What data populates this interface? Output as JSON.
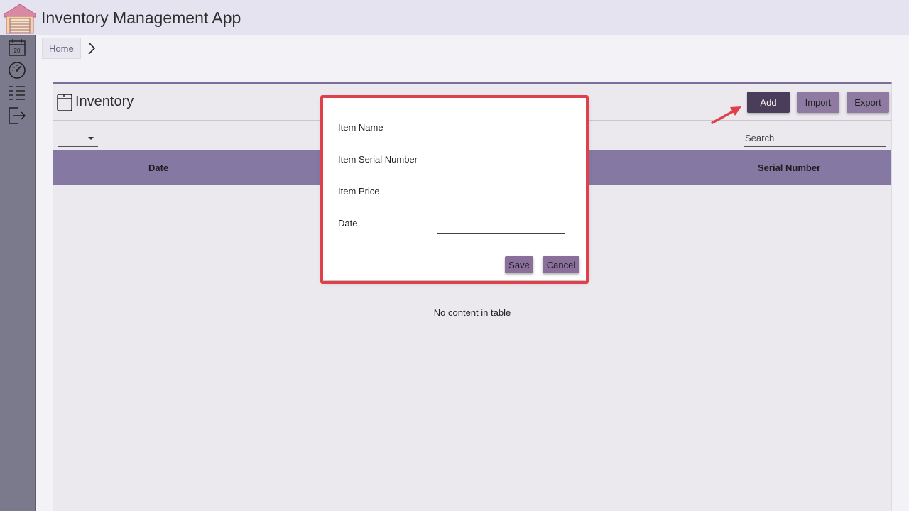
{
  "header": {
    "title": "Inventory Management App",
    "logo_icon": "warehouse-icon"
  },
  "sidebar": {
    "items": [
      {
        "icon": "calendar-icon",
        "text": "20"
      },
      {
        "icon": "dashboard-gauge-icon"
      },
      {
        "icon": "list-icon"
      },
      {
        "icon": "logout-icon"
      }
    ]
  },
  "breadcrumb": {
    "home": "Home"
  },
  "inventory": {
    "title": "Inventory",
    "buttons": {
      "add": "Add",
      "import": "Import",
      "export": "Export"
    },
    "search_placeholder": "Search",
    "columns": [
      "Date",
      "Serial Number"
    ],
    "empty_message": "No content in table"
  },
  "dialog": {
    "fields": [
      {
        "label": "Item Name",
        "value": ""
      },
      {
        "label": "Item Serial Number",
        "value": ""
      },
      {
        "label": "Item Price",
        "value": ""
      },
      {
        "label": "Date",
        "value": ""
      }
    ],
    "save": "Save",
    "cancel": "Cancel"
  },
  "colors": {
    "accent": "#8578a2",
    "sidebar": "#7b7a8d",
    "button_primary": "#4a3d5a",
    "button_secondary": "#8f7aa2",
    "highlight": "#e0404a"
  }
}
